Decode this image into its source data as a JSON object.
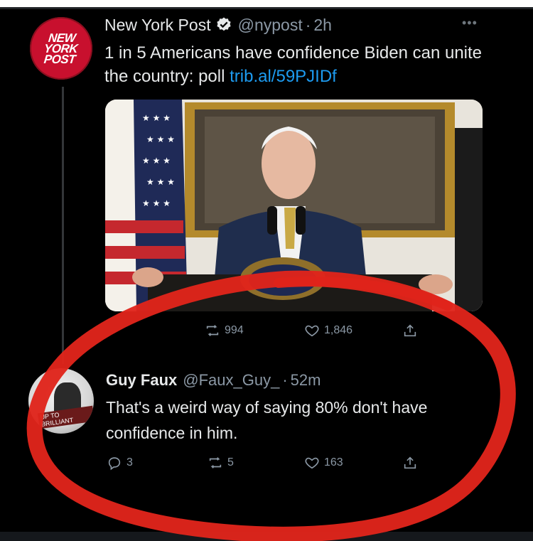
{
  "colors": {
    "accent_link": "#1d9bf0",
    "secondary_text": "#8b98a5",
    "annotation_red": "#e0241b",
    "nyp_red": "#c8102e"
  },
  "tweet1": {
    "avatar_logo": "NEW\nYORK\nPOST",
    "name": "New York Post",
    "handle": "@nypost",
    "separator": "·",
    "time": "2h",
    "text": "1 in 5 Americans have confidence Biden can unite the country: poll ",
    "link": "trib.al/59PJIDf",
    "retweets": "994",
    "likes": "1,846"
  },
  "tweet2": {
    "avatar_badge": "UP TO BRILLIANT",
    "name": "Guy Faux",
    "handle": "@Faux_Guy_",
    "separator": "·",
    "time": "52m",
    "text": "That's a weird way of saying 80% don't have confidence in him.",
    "replies": "3",
    "retweets": "5",
    "likes": "163"
  },
  "icons": [
    "verified-icon",
    "more-icon",
    "reply-icon",
    "retweet-icon",
    "like-icon",
    "share-icon"
  ]
}
